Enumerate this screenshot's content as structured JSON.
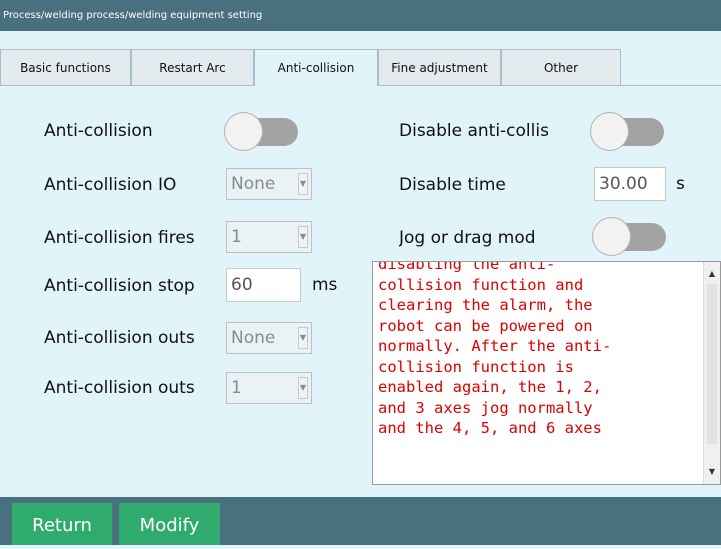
{
  "window": {
    "title": "Process/welding process/welding equipment setting"
  },
  "tabs": [
    {
      "label": "Basic functions"
    },
    {
      "label": "Restart Arc"
    },
    {
      "label": "Anti-collision"
    },
    {
      "label": "Fine adjustment"
    },
    {
      "label": "Other"
    }
  ],
  "active_tab": "Anti-collision",
  "left": {
    "anti_collision": {
      "label": "Anti-collision",
      "enabled": false
    },
    "io": {
      "label": "Anti-collision IO",
      "value": "None"
    },
    "fires": {
      "label": "Anti-collision fires",
      "value": "1"
    },
    "stop": {
      "label": "Anti-collision stop",
      "value": "60",
      "unit": "ms"
    },
    "outs1": {
      "label": "Anti-collision outs",
      "value": "None"
    },
    "outs2": {
      "label": "Anti-collision outs",
      "value": "1"
    }
  },
  "right": {
    "disable": {
      "label": "Disable anti-collis",
      "enabled": false
    },
    "disable_time": {
      "label": "Disable time",
      "value": "30.00",
      "unit": "s"
    },
    "jog": {
      "label": "Jog or drag mod",
      "enabled": false
    },
    "description": "disabling the anti-\ncollision function and\nclearing the alarm, the\nrobot can be powered on\nnormally. After the anti-\ncollision function is\nenabled again, the 1, 2,\nand 3 axes jog normally\nand the 4, 5, and 6 axes"
  },
  "footer": {
    "return_label": "Return",
    "modify_label": "Modify"
  },
  "colors": {
    "titlebar": "#49707f",
    "panel": "#e0f4fa",
    "button": "#2fab6e",
    "description_text": "#dd0000"
  },
  "icons": {
    "scroll_up": "triangle-up",
    "scroll_down": "triangle-down",
    "dropdown": "triangle-down"
  }
}
